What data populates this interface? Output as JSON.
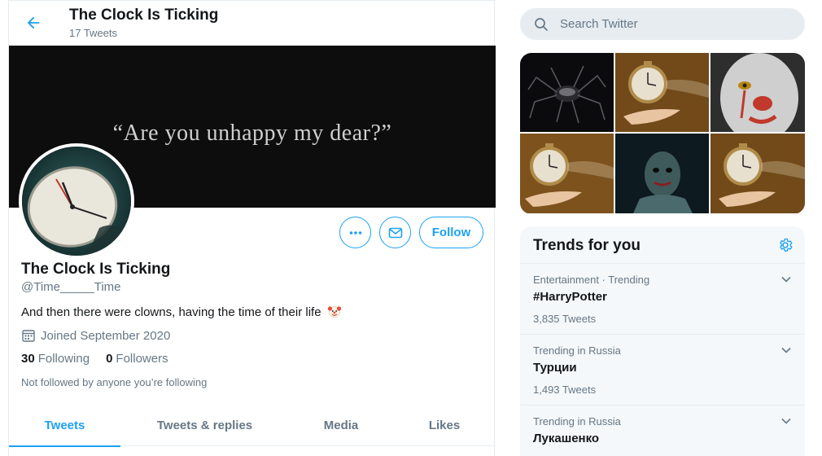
{
  "header": {
    "title": "The Clock Is Ticking",
    "tweet_count": "17 Tweets"
  },
  "banner": {
    "quote": "“Are you unhappy my dear?”"
  },
  "profile": {
    "name": "The Clock Is Ticking",
    "handle": "@Time_____Time",
    "bio": "And then there were clowns, having the time of their life",
    "bio_emoji": "clown-face",
    "joined": "Joined September 2020",
    "following_count": "30",
    "following_label": "Following",
    "followers_count": "0",
    "followers_label": "Followers",
    "not_followed_note": "Not followed by anyone you’re following"
  },
  "actions": {
    "follow_label": "Follow",
    "more_icon": "more-icon",
    "message_icon": "message-icon"
  },
  "tabs": [
    {
      "label": "Tweets",
      "active": true
    },
    {
      "label": "Tweets & replies",
      "active": false
    },
    {
      "label": "Media",
      "active": false
    },
    {
      "label": "Likes",
      "active": false
    }
  ],
  "search": {
    "placeholder": "Search Twitter"
  },
  "media_grid": [
    "dark-spider-image",
    "pocket-watch-image",
    "clown-face-image",
    "pocket-watch-image",
    "clown-in-dark-image",
    "pocket-watch-image"
  ],
  "trends": {
    "title": "Trends for you",
    "items": [
      {
        "meta": "Entertainment · Trending",
        "name": "#HarryPotter",
        "count": "3,835 Tweets"
      },
      {
        "meta": "Trending in Russia",
        "name": "Турции",
        "count": "1,493 Tweets"
      },
      {
        "meta": "Trending in Russia",
        "name": "Лукашенко",
        "count": ""
      }
    ]
  },
  "colors": {
    "accent": "#1da1f2",
    "secondary_text": "#657786",
    "border": "#e6ecf0"
  }
}
